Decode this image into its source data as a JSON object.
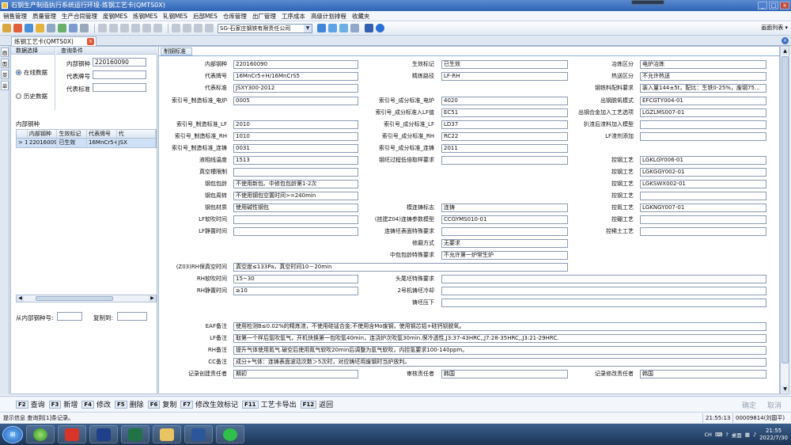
{
  "window": {
    "title": "石钢生产制造执行系统运行环境-炼钢工艺卡(QMTS0X)"
  },
  "menubar": [
    "销售管理",
    "质量管理",
    "生产合同管理",
    "废钢MES",
    "炼钢MES",
    "轧钢MES",
    "后部MES",
    "仓库管理",
    "出厂管理",
    "工序成本",
    "高级计划排程",
    "收藏夹"
  ],
  "toolbar": {
    "company": "SG-石家庄钢铁有限责任公司",
    "screen_list": "画面列表 ▾"
  },
  "tabs": [
    {
      "label": "炼钢工艺卡(QMTS0X)"
    }
  ],
  "vstrip": [
    "画",
    "面",
    "菜",
    "单"
  ],
  "left": {
    "section1": "数据选择",
    "section2": "查询条件",
    "radio_online": "在线数据",
    "radio_history": "历史数据",
    "q_code_label": "内部钢种",
    "q_code_value": "220160090",
    "q_grade_label": "代表牌号",
    "q_grade_value": "",
    "q_std_label": "代表标准",
    "q_std_value": "",
    "list_title": "内部钢种",
    "grid": {
      "headers": [
        "",
        "内部钢种",
        "生效标记",
        "代表牌号",
        "代"
      ],
      "rows": [
        [
          "> 1",
          "220160090",
          "已生效",
          "16MnCr5+...",
          "JSX"
        ]
      ]
    },
    "copy_from_label": "从内部钢种号:",
    "copy_to_label": "复制到:"
  },
  "right": {
    "tab": "制钢标准",
    "f": {
      "l_inner": "内部钢种",
      "v_inner": "220160090",
      "l_grade": "代表牌号",
      "v_grade": "16MnCr5+H/16MnCrS5",
      "l_std": "代表标准",
      "v_std": "JSXY300-2012",
      "l_idx_furnace": "索引号_制造标准_电炉",
      "v_idx_furnace": "0005",
      "l_idx_lf": "索引号_制造标准_LF",
      "v_idx_lf": "2010",
      "l_idx_rh": "索引号_制造标准_RH",
      "v_idx_rh": "1010",
      "l_idx_cc": "索引号_制造标准_连铸",
      "v_idx_cc": "0031",
      "l_liq_temp": "液相线温度",
      "v_liq_temp": "1513",
      "l_vac_slot": "真空槽限制",
      "v_vac_slot": "",
      "l_ladle_pkg": "钢包包龄",
      "v_ladle_pkg": "不使用新包、中修包包龄第1-2次",
      "l_ladle_turn": "钢包周转",
      "v_ladle_turn": "不使用钢包空置时间>=240min",
      "l_ladle_mat": "钢包材质",
      "v_ladle_mat": "使用碱性钢包",
      "l_lf_blow": "LF软吹时间",
      "v_lf_blow": "",
      "l_lf_still": "LF静置时间",
      "v_lf_still": "",
      "l_eff": "生效标记",
      "v_eff": "已生效",
      "l_route": "精炼路径",
      "v_route": "LF-RH",
      "l_comp_furnace": "索引号_成分标准_电炉",
      "v_comp_furnace": "4020",
      "l_comp_lf_in": "索引号_成分标准入LF值",
      "v_comp_lf_in": "EC51",
      "l_comp_lf": "索引号_成分标准_LF",
      "v_comp_lf": "LD37",
      "l_comp_rh": "索引号_成分标准_RH",
      "v_comp_rh": "RC22",
      "l_comp_cc": "索引号_成分标准_连铸",
      "v_comp_cc": "2011",
      "l_low_n": "钢坯过程低倍取样要求",
      "v_low_n": "",
      "l_cc_mark": "模连铸标志",
      "v_cc_mark": "连铸",
      "l_z04": "(挂建Z04)连铸参数模型",
      "v_z04": "CCGYMS010-01",
      "l_slab_surf": "连铸坯表面特殊要求",
      "v_slab_surf": "",
      "l_repair": "修磨方式",
      "v_repair": "无要求",
      "l_ladle_special": "中包包龄特殊要求",
      "v_ladle_special": "不允许第一炉常生炉",
      "l_smelt": "冶炼区分",
      "v_smelt": "电炉冶炼",
      "l_heat_send": "热送区分",
      "v_heat_send": "不允许热送",
      "l_scrap_req": "钢铁料配料要求",
      "v_scrap_req": "装入量144±5t，配比：生铁0-25%，废钢75...",
      "l_tap_mode": "出钢脱氧模式",
      "v_tap_mode": "EFCGTY004-01",
      "l_tap_alloy": "出钢合金加入工艺选项",
      "v_tap_alloy": "LGZLMS007-01",
      "l_alloy_model": "扒渣后渣料加入模型",
      "v_alloy_model": "",
      "l_lf_add": "LF渣剂添加",
      "v_lf_add": "",
      "l_ctl1": "控钢工艺",
      "v_ctl1": "LGKLGY006-01",
      "l_ctl2": "控钢工艺",
      "v_ctl2": "LGKGGY002-01",
      "l_ctl3": "控钢工艺",
      "v_ctl3": "LGKSWX002-01",
      "l_ctl4": "控钢工艺",
      "v_ctl4": "",
      "l_ctl5": "控氮工艺",
      "v_ctl5": "LGKNGY007-01",
      "l_ctl6": "控硼工艺",
      "v_ctl6": "",
      "l_ctl7": "控稀土工艺",
      "v_ctl7": "",
      "l_z03": "(Z03)RH保真空时间",
      "v_z03": "真空度≤133Pa，真空时间10－20min",
      "l_rh_blow": "RH软吹时间",
      "v_rh_blow": "15~30",
      "l_rh_still": "RH静置时间",
      "v_rh_still": "≥10",
      "l_head_cut": "头尾坯特殊要求",
      "v_head_cut": "",
      "l_cc2": "2号机铸坯冷却",
      "v_cc2": "",
      "l_below": "铸坯压下",
      "v_below": "",
      "l_eaf_note": "EAF备注",
      "v_eaf_note": "使用检测B≤0.02%的精炼渣，不使用硅锰合金;不使用含Mo废钢，使用钢芯铝+硅钙钡脱氧。",
      "l_lf_note": "LF备注",
      "v_lf_note": "取第一个样后氩吹氩气，开机快换第一包吹氩40min，连浇炉次吹氩30min.保冷透性,J3:37-43HRC,,J7:28-35HRC,,J3:21-29HRC.",
      "l_rh_note": "RH备注",
      "v_rh_note": "提升气体使用氮气.破空后使用氮气软吹20min后调整为氩气软吹，内控氢要求100-140ppm。",
      "l_cc_note": "CC备注",
      "v_cc_note": "成分+气体：连铸表面波动次数＞5次时，对应铸坯用废钢时当炉放判。",
      "l_rec_creator": "记录创建责任者",
      "v_rec_creator": "期初",
      "l_reviewer": "审核责任者",
      "v_reviewer": "韩国",
      "l_modifier": "记录修改责任者",
      "v_modifier": "韩国"
    }
  },
  "commands": [
    {
      "key": "F2",
      "label": "查询"
    },
    {
      "key": "F3",
      "label": "新增"
    },
    {
      "key": "F4",
      "label": "修改"
    },
    {
      "key": "F5",
      "label": "删除"
    },
    {
      "key": "F6",
      "label": "复制"
    },
    {
      "key": "F7",
      "label": "修改生效标记"
    },
    {
      "key": "F11",
      "label": "工艺卡导出"
    },
    {
      "key": "F12",
      "label": "返回"
    }
  ],
  "cmd_right": {
    "confirm": "确定",
    "cancel": "取消"
  },
  "status": {
    "message": "提示信息 查询到[1]条记录。",
    "time": "21:55:13",
    "user": "00009814(刘国平)"
  },
  "taskbar": {
    "tray_text": "CH",
    "desktop": "桌面",
    "time": "21:55",
    "date": "2022/7/30"
  }
}
